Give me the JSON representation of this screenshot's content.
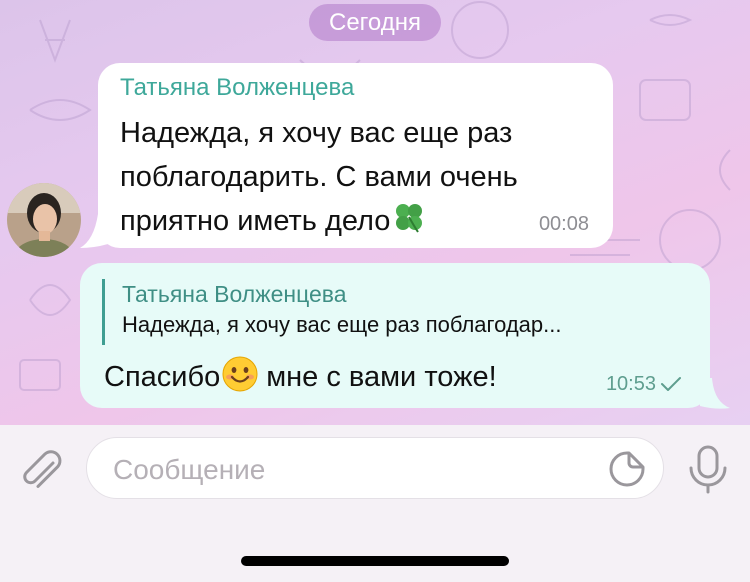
{
  "date_separator": "Сегодня",
  "messages": [
    {
      "direction": "incoming",
      "sender": "Татьяна Волженцева",
      "text": "Надежда, я хочу вас еще раз поблагодарить. С вами очень приятно иметь дело",
      "emoji": "four-leaf-clover",
      "time": "00:08",
      "colors": {
        "bubble": "#ffffff",
        "sender": "#3ea89a"
      }
    },
    {
      "direction": "outgoing",
      "reply_to": {
        "sender": "Татьяна Волженцева",
        "text": "Надежда, я хочу вас еще раз поблагодар..."
      },
      "text_before_emoji": "Спасибо",
      "emoji": "smiling-face",
      "text_after_emoji": "мне с вами тоже!",
      "time": "10:53",
      "status": "sent-check",
      "colors": {
        "bubble": "#e7fbf8",
        "accent": "#3f9e92"
      }
    }
  ],
  "composer": {
    "placeholder": "Сообщение",
    "value": "",
    "attach_icon": "paperclip-icon",
    "sticker_icon": "sticker-icon",
    "mic_icon": "microphone-icon"
  },
  "theme": {
    "background": "#e6c9ef",
    "bar": "#f5f1f6"
  }
}
